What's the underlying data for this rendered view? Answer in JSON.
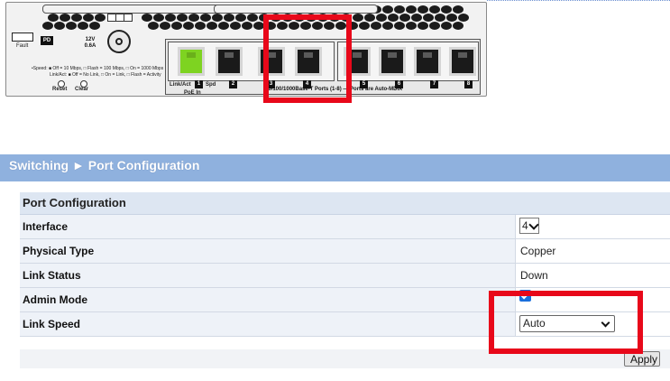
{
  "device": {
    "fault_label": "Fault",
    "pd_label": "PD",
    "power_label": "12V\n0.6A",
    "legend_line1": "•Speed: ■ Off = 10 Mbps, □ Flash = 100 Mbps, □ On = 1000 Mbps",
    "legend_line2": "Link/Act: ■ Off = No Link, □ On = Link, □ Flash = Activity",
    "reset_label": "Reset",
    "clear_label": "Clear",
    "link_act_label": "Link/Act",
    "spd_label": "Spd",
    "poe_in_label": "PoE In",
    "port_numbers": [
      "1",
      "2",
      "3",
      "4",
      "5",
      "6",
      "7",
      "8"
    ],
    "ports_caption": "10/100/1000Base-T Ports (1-8) — Ports are Auto-MDIX",
    "highlighted_port": "4"
  },
  "header": {
    "breadcrumb": "Switching ► Port Configuration"
  },
  "form": {
    "section_title": "Port Configuration",
    "rows": [
      {
        "label": "Interface",
        "value": "4"
      },
      {
        "label": "Physical Type",
        "value": "Copper"
      },
      {
        "label": "Link Status",
        "value": "Down"
      },
      {
        "label": "Admin Mode",
        "value": "checked"
      },
      {
        "label": "Link Speed",
        "value": "Auto"
      }
    ]
  },
  "actions": {
    "apply_label": "Apply"
  },
  "colors": {
    "header_bg": "#8fb1de",
    "highlight": "#e8081a",
    "checkbox": "#1a6fdc",
    "poe_port": "#7ed321"
  }
}
